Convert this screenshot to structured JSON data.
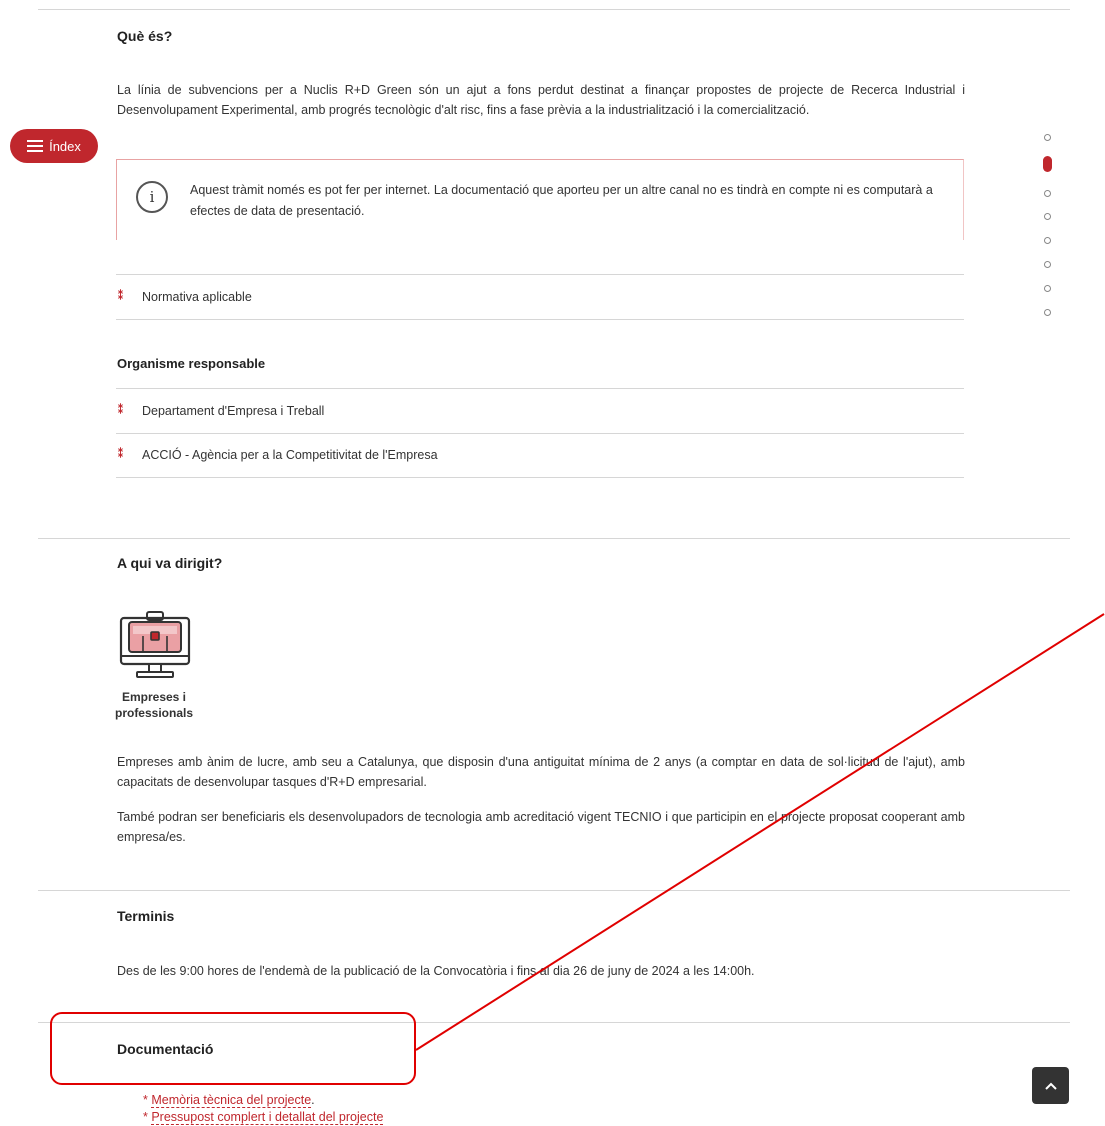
{
  "index_button": {
    "label": "Índex",
    "icon": "hamburger-icon"
  },
  "section_que": {
    "title": "Què és?",
    "description": "La línia de subvencions per a Nuclis R+D Green són un ajut a fons perdut destinat a finançar propostes de projecte de Recerca Industrial i Desenvolupament Experimental, amb progrés tecnològic d'alt risc, fins a fase prèvia a la industrialització i la comercialització.",
    "notice": "Aquest tràmit només es pot fer per internet. La documentació que aporteu per un altre canal no es tindrà en compte ni es computarà a efectes de data de presentació.",
    "link": "Normativa aplicable"
  },
  "organisme": {
    "title": "Organisme responsable",
    "items": [
      {
        "label": "Departament d'Empresa i Treball"
      },
      {
        "label": "ACCIÓ - Agència per a la Competitivitat de l'Empresa"
      }
    ]
  },
  "section_qui": {
    "title": "A qui va dirigit?",
    "target_label": "Empreses i professionals",
    "p1": "Empreses amb ànim de lucre, amb seu a Catalunya, que disposin d'una antiguitat mínima de 2 anys (a comptar en data de sol·licitud de l'ajut), amb capacitats de desenvolupar tasques d'R+D empresarial.",
    "p2": "També podran ser beneficiaris els desenvolupadors de tecnologia amb acreditació vigent TECNIO i que participin en el projecte proposat cooperant amb empresa/es."
  },
  "section_terminis": {
    "title": "Terminis",
    "text": "Des de les 9:00 hores de l'endemà de la publicació de la Convocatòria i fins al dia 26 de juny de 2024 a les 14:00h."
  },
  "section_docs": {
    "title": "Documentació",
    "items": [
      "Memòria tècnica del projecte",
      "Pressupost complert i detallat del projecte"
    ]
  },
  "colors": {
    "accent": "#c0272d",
    "annotation": "#e00000"
  }
}
